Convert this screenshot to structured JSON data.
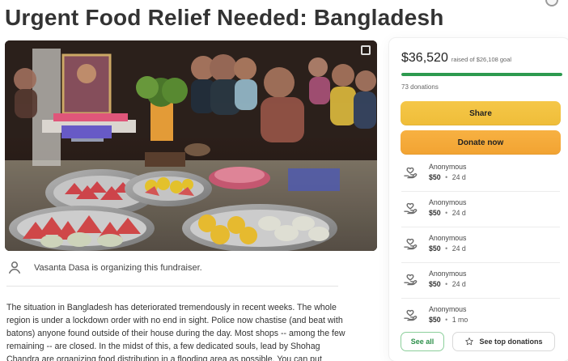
{
  "page": {
    "title": "Urgent Food Relief Needed: Bangladesh"
  },
  "organizer": {
    "text": "Vasanta Dasa is organizing this fundraiser."
  },
  "story": {
    "text": "The situation in Bangladesh has deteriorated tremendously in recent weeks. The whole region is under a lockdown order with no end in sight. Police now chastise (and beat with batons) anyone found outside of their house during the day. Most shops -- among the few remaining -- are closed. In the midst of this, a few dedicated souls, lead by Shohag Chandra are organizing food distribution in a flooding area as possible. You can put"
  },
  "fundraising": {
    "raised_amount": "$36,520",
    "raised_label": "raised of $26,108 goal",
    "progress_ratio": 1,
    "donations_count": "73 donations",
    "share_label": "Share",
    "donate_label": "Donate now",
    "see_all_label": "See all",
    "top_donations_label": "See top donations"
  },
  "donors": [
    {
      "name": "Anonymous",
      "amount": "$50",
      "time": "24 d"
    },
    {
      "name": "Anonymous",
      "amount": "$50",
      "time": "24 d"
    },
    {
      "name": "Anonymous",
      "amount": "$50",
      "time": "24 d"
    },
    {
      "name": "Anonymous",
      "amount": "$50",
      "time": "24 d"
    },
    {
      "name": "Anonymous",
      "amount": "$50",
      "time": "1 mo"
    }
  ],
  "ui": {
    "separator": "•",
    "colors": {
      "progress": "#2d9a4f",
      "share_button": "#f2c140",
      "donate_button": "#f4a73a",
      "see_all_border": "#8ccf9b"
    },
    "icons": {
      "organizer": "user-icon",
      "donor": "donation-hand-icon",
      "photo_corner": "photo-icon",
      "top_donations": "star-icon"
    }
  }
}
